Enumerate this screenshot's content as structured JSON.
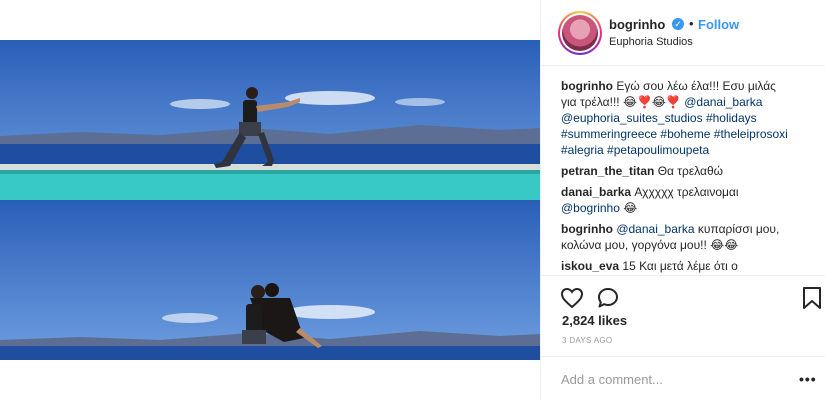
{
  "post": {
    "author": "bogrinho",
    "location": "Euphoria Studios",
    "follow_label": "Follow",
    "dot": "•",
    "verified_mark": "✓",
    "likes": "2,824 likes",
    "time": "3 DAYS AGO",
    "add_comment_placeholder": "Add a comment...",
    "more_label": "•••"
  },
  "caption": {
    "user": "bogrinho",
    "line1": "Εγώ σου λέω έλα!!! Εσυ μιλάς",
    "line2": "για τρέλα!!! 😂❣️😂❣️",
    "tag1": "@danai_barka",
    "tag2": "@euphoria_suites_studios",
    "tag3": "#holidays",
    "tag4": "#summeringreece",
    "tag5": "#boheme",
    "tag6": "#theleiprosoxi",
    "tag7": "#alegria",
    "tag8": "#petapoulimoupeta"
  },
  "comments": [
    {
      "user": "petran_the_titan",
      "text": "Θα τρελαθώ"
    },
    {
      "user": "danai_barka",
      "text": "Αχχχχχ τρελαινομαι",
      "mention": "@bogrinho",
      "emoji": "😂"
    },
    {
      "user": "bogrinho",
      "mention": "@danai_barka",
      "text": "κυπαρίσσι μου,",
      "text2": "κολώνα μου, γοργόνα μου!! 😂😂"
    },
    {
      "user": "iskou_eva",
      "text": "15 Και μετά λέμε ότι ο"
    }
  ],
  "icons": {
    "like": "heart-icon",
    "comment": "comment-bubble-icon",
    "save": "bookmark-icon"
  },
  "colors": {
    "accent": "#3897f0",
    "tag": "#003569",
    "muted": "#999999"
  }
}
